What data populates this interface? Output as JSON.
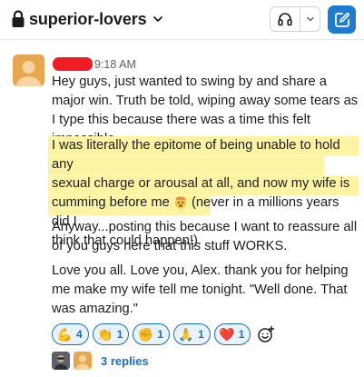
{
  "header": {
    "channel_name": "superior-lovers",
    "private": true
  },
  "colors": {
    "accent": "#1e7bd1",
    "link": "#1d6fc2",
    "highlight": "#fdf4a3",
    "redaction": "#ee1c25",
    "avatar": "#e7a74f"
  },
  "message": {
    "timestamp": "9:18 AM",
    "paragraph1": "Hey guys, just wanted to swing by and share a major win. Truth be told, wiping away some tears as I type this because there was a time this felt impossible.",
    "highlight_lines": [
      "I was literally the epitome of being unable to hold any",
      "sexual charge or arousal at all, and now my wife is",
      "cumming before me",
      " (never in a millions years did I",
      "think that could happen!)."
    ],
    "highlight_emoji": "exploding-head-emoji",
    "paragraph3": "Anyway...posting this because I want to reassure all of you guys here that this stuff WORKS.",
    "paragraph4": "Love you all. Love you, Alex. thank you for helping me make my wife tell me tonight. \"Well done. That was amazing.\""
  },
  "reactions": [
    {
      "emoji": "💪",
      "icon": "flexed-biceps-emoji",
      "count": "4"
    },
    {
      "emoji": "👏",
      "icon": "clapping-hands-emoji",
      "count": "1"
    },
    {
      "emoji": "✊",
      "icon": "raised-fist-emoji",
      "count": "1"
    },
    {
      "emoji": "🙏",
      "icon": "folded-hands-emoji",
      "count": "1"
    },
    {
      "emoji": "❤️",
      "icon": "red-heart-emoji",
      "count": "1"
    }
  ],
  "thread": {
    "replies_label": "3 replies"
  }
}
